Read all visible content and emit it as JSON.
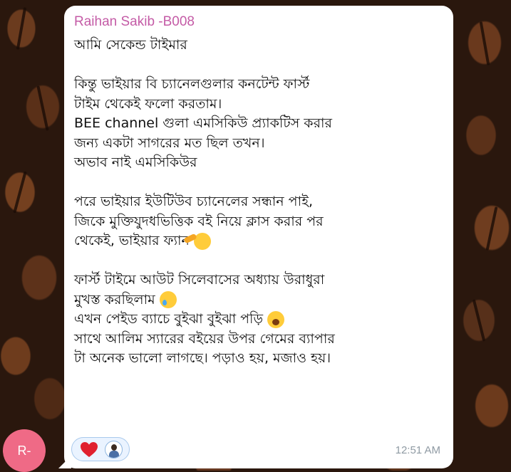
{
  "chat": {
    "message": {
      "sender": "Raihan Sakib -B008",
      "lines": [
        "আমি সেকেন্ড টাইমার",
        "",
        "কিন্তু ভাইয়ার বি চ্যানেলগুলার কনটেন্ট ফার্স্ট",
        "টাইম থেকেই ফলো করতাম।",
        "BEE channel গুলা এমসিকিউ প্র্যাকটিস করার",
        "জন্য একটা  সাগরের মত ছিল তখন।",
        "অভাব নাই এমসিকিউর",
        "",
        "পরে ভাইয়ার ইউটিউব চ্যানেলের সন্ধান পাই,",
        "জিকে মুক্তিযুদধভিত্তিক বই নিয়ে ক্লাস করার পর",
        "থেকেই, ভাইয়ার ফ্যান",
        "",
        "ফার্স্ট টাইমে আউট সিলেবাসের অধ্যায় উরাধুরা",
        "মুখস্ত করছিলাম",
        "এখন পেইড ব্যাচে  বুইঝা বুইঝা পড়ি",
        "সাথে আলিম স্যারের বইয়ের উপর গেমের ব্যাপার",
        "টা অনেক ভালো লাগছে। পড়াও হয়, মজাও হয়।"
      ],
      "emojis": {
        "line_10": "saluting-face",
        "line_13": "crying-face",
        "line_14": "yawning-face"
      },
      "reactions": [
        {
          "icon": "heart-icon",
          "color": "#e0202e"
        },
        {
          "icon": "reactor-avatar"
        }
      ],
      "time": "12:51 AM"
    },
    "sender_avatar": {
      "initials": "R-",
      "color": "#ef6a86"
    },
    "colors": {
      "sender_name": "#c45ba6",
      "bubble": "#ffffff",
      "reaction_bg": "#eaf3ff",
      "time": "#8f9aa3"
    }
  }
}
